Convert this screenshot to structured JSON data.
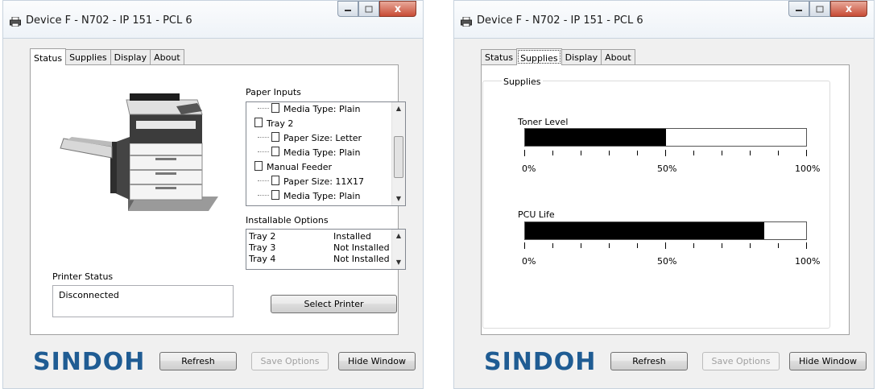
{
  "window": {
    "title": "Device F - N702 - IP 151 - PCL 6",
    "close_glyph": "x"
  },
  "tabs": [
    "Status",
    "Supplies",
    "Display",
    "About"
  ],
  "status_tab": {
    "paper_inputs_label": "Paper Inputs",
    "paper_inputs": [
      {
        "text": "Media Type: Plain",
        "level": 1
      },
      {
        "text": "Tray 2",
        "level": 0
      },
      {
        "text": "Paper Size: Letter",
        "level": 1
      },
      {
        "text": "Media Type: Plain",
        "level": 1
      },
      {
        "text": "Manual Feeder",
        "level": 0
      },
      {
        "text": "Paper Size: 11X17",
        "level": 1
      },
      {
        "text": "Media Type: Plain",
        "level": 1
      }
    ],
    "installable_options_label": "Installable Options",
    "installable_options": [
      {
        "name": "Tray 2",
        "value": "Installed"
      },
      {
        "name": "Tray 3",
        "value": "Not Installed"
      },
      {
        "name": "Tray 4",
        "value": "Not Installed"
      }
    ],
    "printer_status_label": "Printer Status",
    "printer_status_value": "Disconnected",
    "select_printer_label": "Select Printer"
  },
  "supplies_tab": {
    "group_label": "Supplies",
    "toner_label": "Toner Level",
    "toner_level": 0.5,
    "pcu_label": "PCU Life",
    "pcu_level": 0.85,
    "scale_labels": [
      "0%",
      "50%",
      "100%"
    ]
  },
  "footer": {
    "logo": "SINDOH",
    "refresh_label": "Refresh",
    "save_options_label": "Save Options",
    "hide_window_label": "Hide Window"
  },
  "colors": {
    "logo": "#1f5c93",
    "close_button": "#c74b35",
    "bar_fill": "#000000"
  }
}
